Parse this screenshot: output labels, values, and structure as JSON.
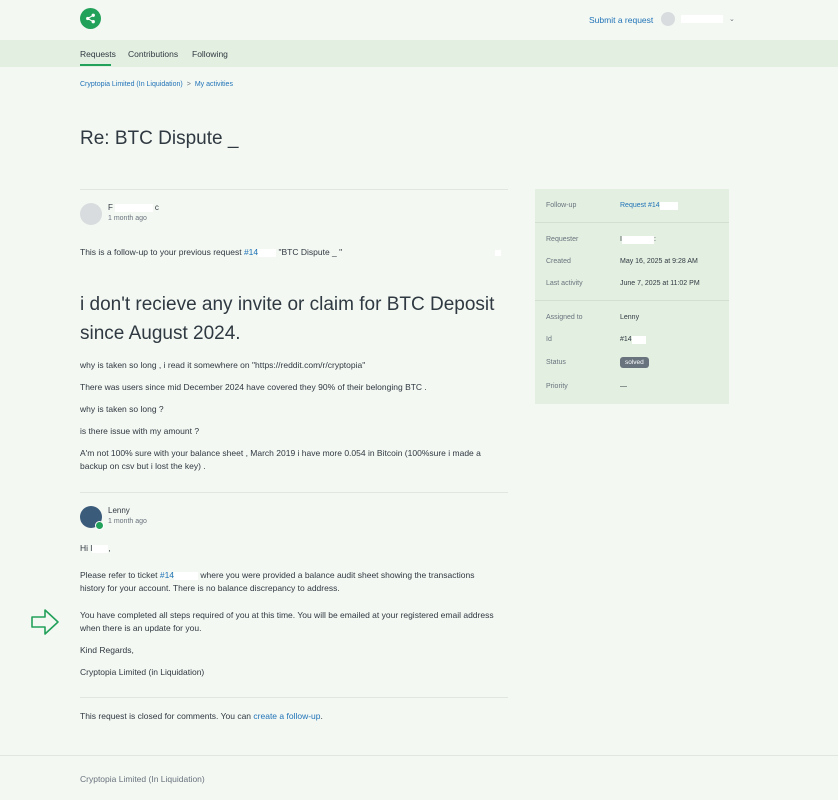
{
  "header": {
    "submit_label": "Submit a request",
    "user_name": "",
    "logo_icon": "share-icon",
    "brand_color": "#22a15a"
  },
  "nav": {
    "tabs": [
      {
        "label": "Requests",
        "active": true
      },
      {
        "label": "Contributions",
        "active": false
      },
      {
        "label": "Following",
        "active": false
      }
    ]
  },
  "breadcrumb": [
    "Cryptopia Limited (In Liquidation)",
    "My activities"
  ],
  "breadcrumb_sep": ">",
  "request": {
    "title": "Re: BTC Dispute _"
  },
  "comments": [
    {
      "author": "F",
      "author_suffix": "c",
      "time": "1 month ago",
      "followup_prefix": "This is a follow-up to your previous request ",
      "followup_link": "#14",
      "followup_title": "\"BTC Dispute _ \"",
      "heading": "i don't recieve any invite or claim for BTC Deposit since August 2024.",
      "paragraphs": [
        "why is taken so long , i read it somewhere on \"https://reddit.com/r/cryptopia\"",
        "There was users since mid December 2024 have covered they 90% of their belonging BTC .",
        "why is taken so long ?",
        "is there issue with my amount ?",
        "A'm not 100% sure with your balance sheet , March 2019 i have more 0.054 in Bitcoin (100%sure i made a backup on csv but i lost the key) ."
      ]
    },
    {
      "author": "Lenny",
      "time": "1 month ago",
      "greeting": "Hi l",
      "greeting_end": ",",
      "p1_prefix": "Please refer to ticket ",
      "p1_link": "#14",
      "p1_suffix": " where you were provided a balance audit sheet showing the transactions history for your account. There is no balance discrepancy to address.",
      "p2": "You have completed all steps required of you at this time. You will be emailed at your registered email address when there is an update for you.",
      "p3": "Kind Regards,",
      "p4": "Cryptopia Limited (in Liquidation)"
    }
  ],
  "closed": {
    "prefix": "This request is closed for comments. You can ",
    "link": "create a follow-up",
    "suffix": "."
  },
  "sidebar": {
    "followup_label": "Follow-up",
    "followup_value": "Request #14",
    "requester_label": "Requester",
    "requester_value": "I",
    "requester_suffix": ":",
    "created_label": "Created",
    "created_value": "May 16, 2025 at 9:28 AM",
    "last_activity_label": "Last activity",
    "last_activity_value": "June 7, 2025 at 11:02 PM",
    "assigned_label": "Assigned to",
    "assigned_value": "Lenny",
    "id_label": "Id",
    "id_value": "#14",
    "status_label": "Status",
    "status_value": "solved",
    "priority_label": "Priority",
    "priority_value": "—"
  },
  "footer": {
    "text": "Cryptopia Limited (In Liquidation)"
  }
}
